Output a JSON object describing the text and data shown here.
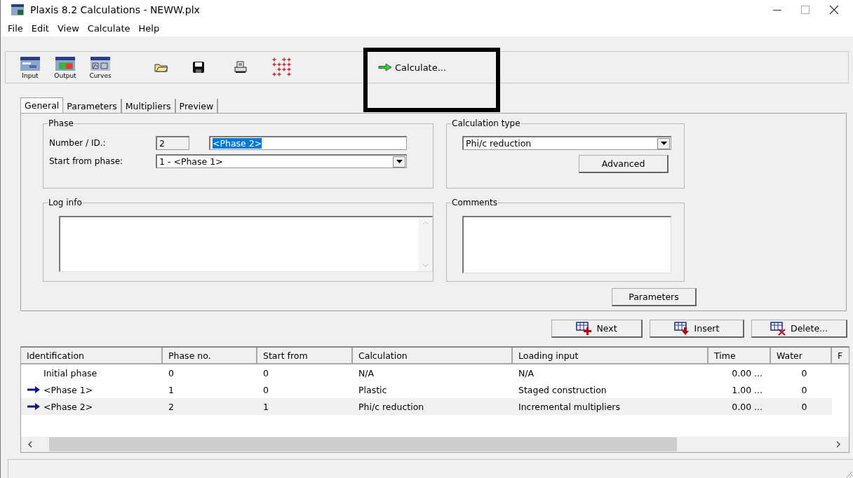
{
  "window": {
    "title": "Plaxis 8.2 Calculations - NEWW.plx"
  },
  "menu": [
    "File",
    "Edit",
    "View",
    "Calculate",
    "Help"
  ],
  "toolbar": {
    "tools": [
      {
        "label": "Input",
        "kind": "input"
      },
      {
        "label": "Output",
        "kind": "output"
      },
      {
        "label": "Curves",
        "kind": "curves"
      }
    ],
    "calculate_button": "Calculate...",
    "calculate_highlighted": true
  },
  "tabs": [
    {
      "label": "General",
      "selected": true
    },
    {
      "label": "Parameters",
      "selected": false
    },
    {
      "label": "Multipliers",
      "selected": false
    },
    {
      "label": "Preview",
      "selected": false
    }
  ],
  "phase": {
    "title": "Phase",
    "number_label": "Number / ID.:",
    "number": "2",
    "number_disabled": true,
    "id": "<Phase 2>",
    "id_selected": true,
    "start_label": "Start from phase:",
    "start_value": "1 - <Phase 1>"
  },
  "calculation_type": {
    "title": "Calculation type",
    "value": "Phi/c reduction",
    "advanced_button": "Advanced"
  },
  "log_info": {
    "title": "Log info"
  },
  "comments": {
    "title": "Comments"
  },
  "parameters_button": "Parameters",
  "phase_buttons": [
    {
      "label": "Next",
      "kind": "next"
    },
    {
      "label": "Insert",
      "kind": "insert"
    },
    {
      "label": "Delete...",
      "kind": "delete"
    }
  ],
  "table": {
    "columns": [
      "Identification",
      "Phase no.",
      "Start from",
      "Calculation",
      "Loading input",
      "Time",
      "Water",
      "F"
    ],
    "rows": [
      {
        "cells": [
          "Initial phase",
          "0",
          "0",
          "N/A",
          "N/A",
          "0.00 ...",
          "0"
        ],
        "arrow": false,
        "selected": false
      },
      {
        "cells": [
          "<Phase 1>",
          "1",
          "0",
          "Plastic",
          "Staged construction",
          "1.00 ...",
          "0"
        ],
        "arrow": true,
        "selected": false
      },
      {
        "cells": [
          "<Phase 2>",
          "2",
          "1",
          "Phi/c reduction",
          "Incremental multipliers",
          "0.00 ...",
          "0"
        ],
        "arrow": true,
        "selected": true
      }
    ]
  }
}
